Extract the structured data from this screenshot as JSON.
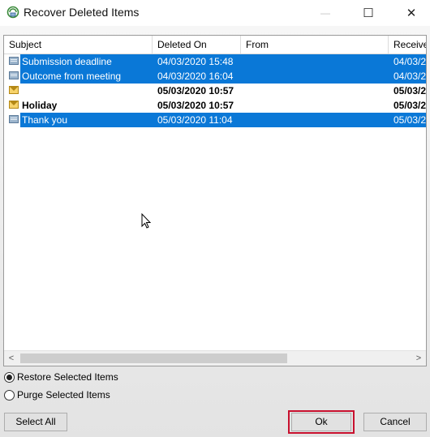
{
  "window": {
    "title": "Recover Deleted Items",
    "icons": {
      "app": "recover-items-icon",
      "minimize": "minimize-icon",
      "maximize": "maximize-icon",
      "close": "close-icon"
    },
    "controls": {
      "minimize": "—",
      "maximize": "☐",
      "close": "✕"
    }
  },
  "list": {
    "columns": [
      "Subject",
      "Deleted On",
      "From",
      "Received"
    ],
    "rows": [
      {
        "icon": "read-mail-icon",
        "subject": "Submission deadline",
        "deleted_on": "04/03/2020 15:48",
        "from": "",
        "received": "04/03/2",
        "selected": true,
        "bold": false
      },
      {
        "icon": "read-mail-icon",
        "subject": "Outcome from meeting",
        "deleted_on": "04/03/2020 16:04",
        "from": "",
        "received": "04/03/2",
        "selected": true,
        "bold": false
      },
      {
        "icon": "unread-mail-icon",
        "subject": "",
        "deleted_on": "05/03/2020 10:57",
        "from": "",
        "received": "05/03/2",
        "selected": false,
        "bold": true
      },
      {
        "icon": "unread-mail-icon",
        "subject": "Holiday",
        "deleted_on": "05/03/2020 10:57",
        "from": "",
        "received": "05/03/2",
        "selected": false,
        "bold": true
      },
      {
        "icon": "read-mail-icon",
        "subject": "Thank you",
        "deleted_on": "05/03/2020 11:04",
        "from": "",
        "received": "05/03/2",
        "selected": true,
        "bold": false
      }
    ],
    "scroll": {
      "left_arrow": "<",
      "right_arrow": ">"
    }
  },
  "options": {
    "restore_label": "Restore Selected Items",
    "purge_label": "Purge Selected Items",
    "selected": "restore"
  },
  "buttons": {
    "select_all": "Select All",
    "ok": "Ok",
    "cancel": "Cancel"
  },
  "colors": {
    "selection": "#0a78d7",
    "focus_highlight": "#c8102e"
  }
}
